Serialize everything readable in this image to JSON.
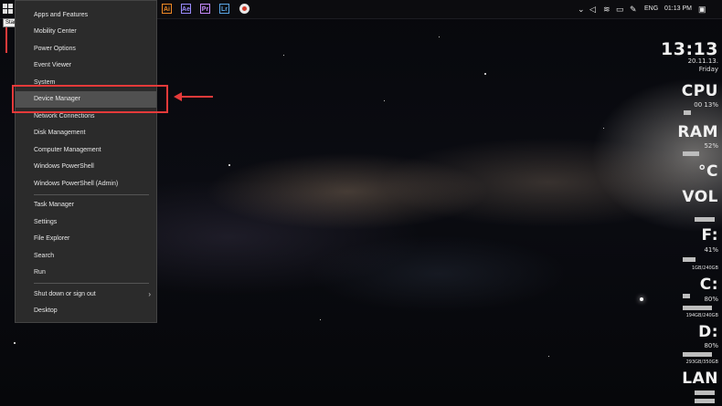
{
  "taskbar": {
    "apps": [
      {
        "label": "Ai",
        "color": "#f08a24"
      },
      {
        "label": "Ae",
        "color": "#9a8bff"
      },
      {
        "label": "Pr",
        "color": "#c78bff"
      },
      {
        "label": "Lr",
        "color": "#5aa6e6"
      }
    ],
    "tray": {
      "language": "ENG",
      "time": "01:13 PM"
    }
  },
  "start_tooltip": "Start",
  "menu": {
    "items": [
      "Apps and Features",
      "Mobility Center",
      "Power Options",
      "Event Viewer",
      "System",
      "Device Manager",
      "Network Connections",
      "Disk Management",
      "Computer Management",
      "Windows PowerShell",
      "Windows PowerShell (Admin)",
      "Task Manager",
      "Settings",
      "File Explorer",
      "Search",
      "Run",
      "Shut down or sign out",
      "Desktop"
    ],
    "selected": "Device Manager"
  },
  "rainmeter": {
    "clock": "13:13",
    "date": "20.11.13.",
    "day": "Friday",
    "cpu_label": "CPU",
    "cpu_values": "00  13%",
    "ram_label": "RAM",
    "ram_value": "52%",
    "temp_label": "°C",
    "vol_label": "VOL",
    "f_label": "F:",
    "f_value": "41%",
    "f_size": "1GB/240GB",
    "c_label": "C:",
    "c_value": "80%",
    "c_size": "194GB/240GB",
    "d_label": "D:",
    "d_value": "80%",
    "d_size": "293GB/350GB",
    "lan_label": "LAN"
  },
  "colors": {
    "highlight": "#e53a3a",
    "menu_bg": "#2b2b2b",
    "menu_selected": "#505050"
  }
}
